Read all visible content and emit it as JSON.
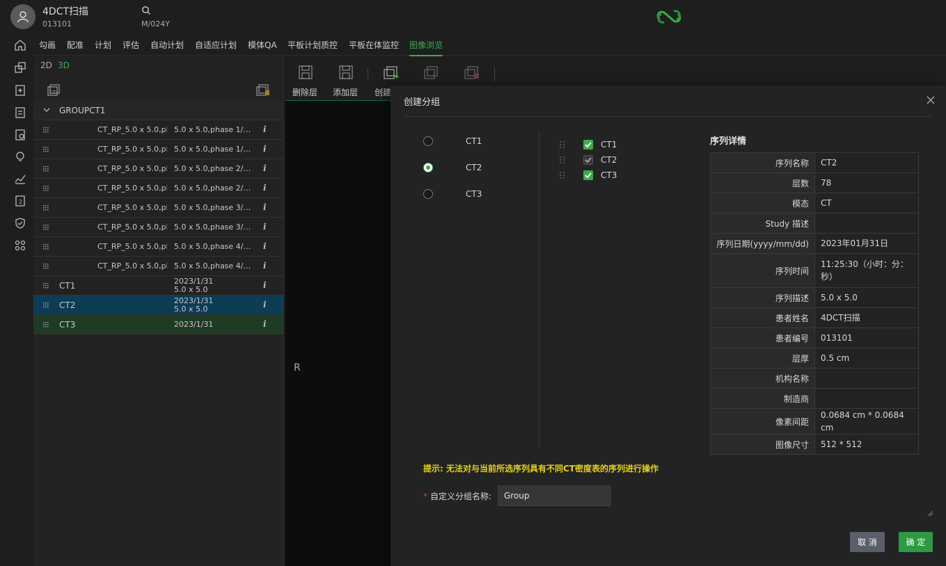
{
  "header": {
    "patient_name": "4DCT扫描",
    "patient_id": "013101",
    "patient_info": "M/024Y"
  },
  "rail_icons": [
    "home-icon",
    "layers-icon",
    "clipboard-plus-icon",
    "clipboard-list-icon",
    "clipboard-check-icon",
    "lightbulb-icon",
    "chart-icon",
    "report-icon",
    "shield-icon",
    "apps-icon"
  ],
  "modules": {
    "items": [
      "勾画",
      "配准",
      "计划",
      "评估",
      "自动计划",
      "自适应计划",
      "模体QA",
      "平板计划质控",
      "平板在体监控",
      "图像浏览"
    ],
    "active": "图像浏览"
  },
  "left_panel": {
    "tab_2d": "2D",
    "tab_3d": "3D",
    "group_label": "GROUPCT1",
    "phase_rows": [
      {
        "name": "CT_RP_5.0 x 5.0,ph",
        "desc": "5.0 x 5.0,phase 1/8 ..."
      },
      {
        "name": "CT_RP_5.0 x 5.0,ph",
        "desc": "5.0 x 5.0,phase 1/8 ..."
      },
      {
        "name": "CT_RP_5.0 x 5.0,ph",
        "desc": "5.0 x 5.0,phase 2/8 ..."
      },
      {
        "name": "CT_RP_5.0 x 5.0,ph",
        "desc": "5.0 x 5.0,phase 2/8 ..."
      },
      {
        "name": "CT_RP_5.0 x 5.0,ph",
        "desc": "5.0 x 5.0,phase 3/8 ..."
      },
      {
        "name": "CT_RP_5.0 x 5.0,ph",
        "desc": "5.0 x 5.0,phase 3/8 ..."
      },
      {
        "name": "CT_RP_5.0 x 5.0,ph",
        "desc": "5.0 x 5.0,phase 4/8 ..."
      },
      {
        "name": "CT_RP_5.0 x 5.0,ph",
        "desc": "5.0 x 5.0,phase 4/8 ..."
      }
    ],
    "series_rows": [
      {
        "name": "CT1",
        "date": "2023/1/31",
        "size": "5.0 x 5.0"
      },
      {
        "name": "CT2",
        "date": "2023/1/31",
        "size": "5.0 x 5.0"
      },
      {
        "name": "CT3",
        "date": "2023/1/31",
        "size": ""
      }
    ],
    "info_glyph": "i"
  },
  "viewer": {
    "tools": {
      "delete_layer": "删除层",
      "add_layer": "添加层",
      "create": "创建"
    },
    "orientation": "R"
  },
  "dialog": {
    "title": "创建分组",
    "radios": [
      {
        "label": "CT1",
        "checked": false
      },
      {
        "label": "CT2",
        "checked": true
      },
      {
        "label": "CT3",
        "checked": false
      }
    ],
    "checkboxes": [
      {
        "label": "CT1",
        "checked": true
      },
      {
        "label": "CT2",
        "checked": true
      },
      {
        "label": "CT3",
        "checked": true
      }
    ],
    "details_title": "序列详情",
    "details": [
      {
        "key": "序列名称",
        "value": "CT2"
      },
      {
        "key": "层数",
        "value": "78"
      },
      {
        "key": "模态",
        "value": "CT"
      },
      {
        "key": "Study 描述",
        "value": ""
      },
      {
        "key": "序列日期(yyyy/mm/dd)",
        "value": "2023年01月31日"
      },
      {
        "key": "序列时间",
        "value": "11:25:30（小时：分：秒）"
      },
      {
        "key": "序列描述",
        "value": "5.0 x 5.0"
      },
      {
        "key": "患者姓名",
        "value": "4DCT扫描"
      },
      {
        "key": "患者编号",
        "value": "013101"
      },
      {
        "key": "层厚",
        "value": "0.5 cm"
      },
      {
        "key": "机构名称",
        "value": ""
      },
      {
        "key": "制造商",
        "value": ""
      },
      {
        "key": "像素间距",
        "value": "0.0684 cm * 0.0684 cm"
      },
      {
        "key": "图像尺寸",
        "value": "512 * 512"
      }
    ],
    "hint": "提示: 无法对与当前所选序列具有不同CT密度表的序列进行操作",
    "required_mark": "*",
    "name_label": "自定义分组名称:",
    "name_value": "Group",
    "cancel_label": "取 消",
    "ok_label": "确 定"
  },
  "colors": {
    "accent": "#3faa4e",
    "hint": "#e3d21c",
    "selected_blue": "#0d3c55",
    "selected_green": "#1f3b24"
  }
}
